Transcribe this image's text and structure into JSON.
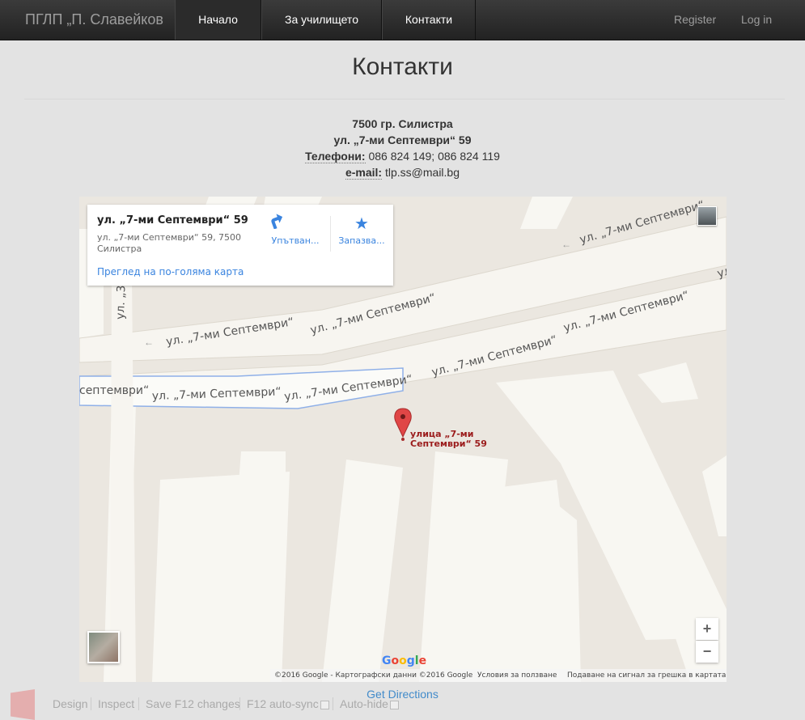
{
  "navbar": {
    "brand": "ПГЛП „П. Славейков",
    "items": [
      {
        "label": "Начало",
        "active": true
      },
      {
        "label": "За училището",
        "active": false
      },
      {
        "label": "Контакти",
        "active": false
      }
    ],
    "register": "Register",
    "login": "Log in"
  },
  "page": {
    "title": "Контакти",
    "city": "7500 гр. Силистра",
    "street": "ул. „7-ми Септември“ 59",
    "phones_label": "Телефони:",
    "phones": "086 824 149; 086 824 119",
    "email_label": "e-mail:",
    "email": "tlp.ss@mail.bg"
  },
  "map": {
    "card": {
      "title": "ул. „7-ми Септември“ 59",
      "address": "ул. „7-ми Септември“ 59, 7500 Силистра",
      "larger_map_link": "Преглед на по-голяма карта",
      "directions_btn": "Упътван...",
      "save_btn": "Запазва...",
      "directions_icon": "directions-arrow-icon",
      "save_icon": "star-icon"
    },
    "road_label": "ул. „7-ми Септември“",
    "road_label_partial": "септември“",
    "side_street_label": "ул. „3",
    "marker_label": "улица „7-ми Септември“ 59",
    "google_logo": "Google",
    "zoom_in": "+",
    "zoom_out": "−",
    "footer": {
      "copyright": "©2016 Google - Картографски данни ©2016 Google",
      "terms": "Условия за ползване",
      "report": "Подаване на сигнал за грешка в картата"
    },
    "colors": {
      "land": "#ebe7e0",
      "building": "#f8f7f2",
      "road": "#f7f5f0",
      "marker": "#e04646",
      "link": "#3a84df"
    }
  },
  "get_directions": "Get Directions",
  "devbar": {
    "design": "Design",
    "inspect": "Inspect",
    "save": "Save F12 changes",
    "autosync": "F12 auto-sync",
    "autohide": "Auto-hide"
  }
}
